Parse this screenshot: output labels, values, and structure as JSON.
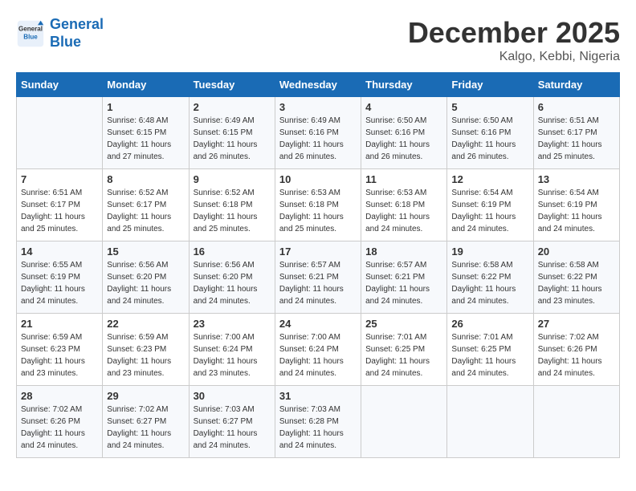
{
  "header": {
    "logo_line1": "General",
    "logo_line2": "Blue",
    "month": "December 2025",
    "location": "Kalgo, Kebbi, Nigeria"
  },
  "days_of_week": [
    "Sunday",
    "Monday",
    "Tuesday",
    "Wednesday",
    "Thursday",
    "Friday",
    "Saturday"
  ],
  "weeks": [
    [
      {
        "day": "",
        "content": ""
      },
      {
        "day": "1",
        "content": "Sunrise: 6:48 AM\nSunset: 6:15 PM\nDaylight: 11 hours and 27 minutes."
      },
      {
        "day": "2",
        "content": "Sunrise: 6:49 AM\nSunset: 6:15 PM\nDaylight: 11 hours and 26 minutes."
      },
      {
        "day": "3",
        "content": "Sunrise: 6:49 AM\nSunset: 6:16 PM\nDaylight: 11 hours and 26 minutes."
      },
      {
        "day": "4",
        "content": "Sunrise: 6:50 AM\nSunset: 6:16 PM\nDaylight: 11 hours and 26 minutes."
      },
      {
        "day": "5",
        "content": "Sunrise: 6:50 AM\nSunset: 6:16 PM\nDaylight: 11 hours and 26 minutes."
      },
      {
        "day": "6",
        "content": "Sunrise: 6:51 AM\nSunset: 6:17 PM\nDaylight: 11 hours and 25 minutes."
      }
    ],
    [
      {
        "day": "7",
        "content": "Sunrise: 6:51 AM\nSunset: 6:17 PM\nDaylight: 11 hours and 25 minutes."
      },
      {
        "day": "8",
        "content": "Sunrise: 6:52 AM\nSunset: 6:17 PM\nDaylight: 11 hours and 25 minutes."
      },
      {
        "day": "9",
        "content": "Sunrise: 6:52 AM\nSunset: 6:18 PM\nDaylight: 11 hours and 25 minutes."
      },
      {
        "day": "10",
        "content": "Sunrise: 6:53 AM\nSunset: 6:18 PM\nDaylight: 11 hours and 25 minutes."
      },
      {
        "day": "11",
        "content": "Sunrise: 6:53 AM\nSunset: 6:18 PM\nDaylight: 11 hours and 24 minutes."
      },
      {
        "day": "12",
        "content": "Sunrise: 6:54 AM\nSunset: 6:19 PM\nDaylight: 11 hours and 24 minutes."
      },
      {
        "day": "13",
        "content": "Sunrise: 6:54 AM\nSunset: 6:19 PM\nDaylight: 11 hours and 24 minutes."
      }
    ],
    [
      {
        "day": "14",
        "content": "Sunrise: 6:55 AM\nSunset: 6:19 PM\nDaylight: 11 hours and 24 minutes."
      },
      {
        "day": "15",
        "content": "Sunrise: 6:56 AM\nSunset: 6:20 PM\nDaylight: 11 hours and 24 minutes."
      },
      {
        "day": "16",
        "content": "Sunrise: 6:56 AM\nSunset: 6:20 PM\nDaylight: 11 hours and 24 minutes."
      },
      {
        "day": "17",
        "content": "Sunrise: 6:57 AM\nSunset: 6:21 PM\nDaylight: 11 hours and 24 minutes."
      },
      {
        "day": "18",
        "content": "Sunrise: 6:57 AM\nSunset: 6:21 PM\nDaylight: 11 hours and 24 minutes."
      },
      {
        "day": "19",
        "content": "Sunrise: 6:58 AM\nSunset: 6:22 PM\nDaylight: 11 hours and 24 minutes."
      },
      {
        "day": "20",
        "content": "Sunrise: 6:58 AM\nSunset: 6:22 PM\nDaylight: 11 hours and 23 minutes."
      }
    ],
    [
      {
        "day": "21",
        "content": "Sunrise: 6:59 AM\nSunset: 6:23 PM\nDaylight: 11 hours and 23 minutes."
      },
      {
        "day": "22",
        "content": "Sunrise: 6:59 AM\nSunset: 6:23 PM\nDaylight: 11 hours and 23 minutes."
      },
      {
        "day": "23",
        "content": "Sunrise: 7:00 AM\nSunset: 6:24 PM\nDaylight: 11 hours and 23 minutes."
      },
      {
        "day": "24",
        "content": "Sunrise: 7:00 AM\nSunset: 6:24 PM\nDaylight: 11 hours and 24 minutes."
      },
      {
        "day": "25",
        "content": "Sunrise: 7:01 AM\nSunset: 6:25 PM\nDaylight: 11 hours and 24 minutes."
      },
      {
        "day": "26",
        "content": "Sunrise: 7:01 AM\nSunset: 6:25 PM\nDaylight: 11 hours and 24 minutes."
      },
      {
        "day": "27",
        "content": "Sunrise: 7:02 AM\nSunset: 6:26 PM\nDaylight: 11 hours and 24 minutes."
      }
    ],
    [
      {
        "day": "28",
        "content": "Sunrise: 7:02 AM\nSunset: 6:26 PM\nDaylight: 11 hours and 24 minutes."
      },
      {
        "day": "29",
        "content": "Sunrise: 7:02 AM\nSunset: 6:27 PM\nDaylight: 11 hours and 24 minutes."
      },
      {
        "day": "30",
        "content": "Sunrise: 7:03 AM\nSunset: 6:27 PM\nDaylight: 11 hours and 24 minutes."
      },
      {
        "day": "31",
        "content": "Sunrise: 7:03 AM\nSunset: 6:28 PM\nDaylight: 11 hours and 24 minutes."
      },
      {
        "day": "",
        "content": ""
      },
      {
        "day": "",
        "content": ""
      },
      {
        "day": "",
        "content": ""
      }
    ]
  ]
}
